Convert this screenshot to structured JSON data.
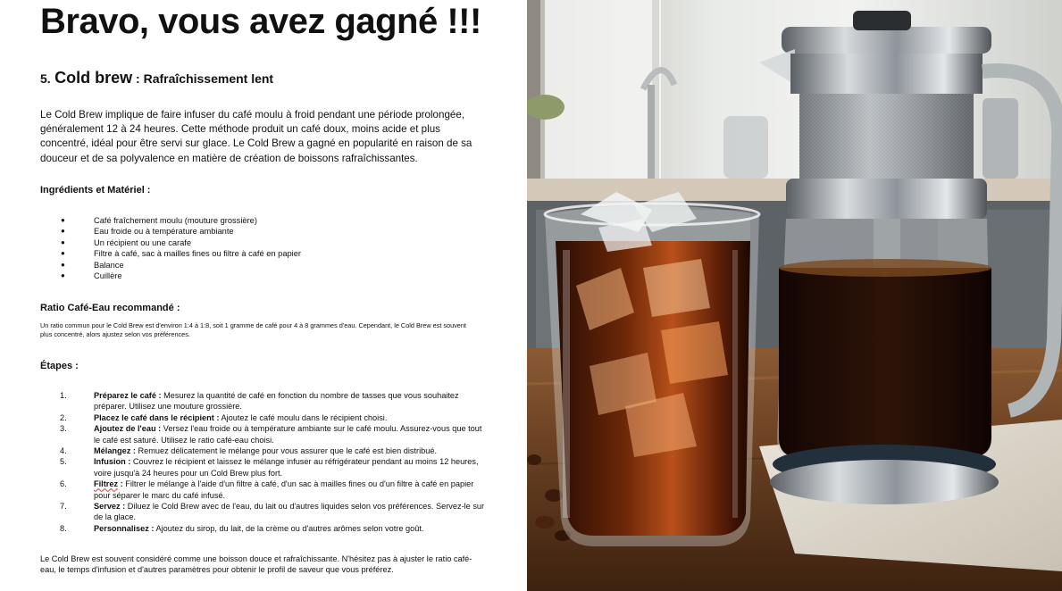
{
  "page_title": "Bravo, vous avez gagné !!!",
  "section": {
    "number": "5.",
    "title_main": "Cold brew",
    "title_rest": " : Rafraîchissement lent"
  },
  "intro": "Le Cold Brew implique de faire infuser du café moulu à froid pendant une période prolongée, généralement 12 à 24 heures. Cette méthode produit un café doux, moins acide et plus concentré, idéal pour être servi sur glace. Le Cold Brew a gagné en popularité en raison de sa douceur et de sa polyvalence en matière de création de boissons rafraîchissantes.",
  "ingredients": {
    "heading": "Ingrédients et Matériel :",
    "bullet": "●",
    "items": [
      "Café fraîchement moulu (mouture grossière)",
      "Eau froide ou à température ambiante",
      "Un récipient ou une carafe",
      "Filtre à café, sac à mailles fines ou filtre à café en papier",
      "Balance",
      "Cuillère"
    ]
  },
  "ratio": {
    "heading": "Ratio Café-Eau recommandé :",
    "text": "Un ratio commun pour le Cold Brew est d'environ 1:4 à 1:8, soit 1 gramme de café pour 4 à 8 grammes d'eau. Cependant, le Cold Brew est souvent plus concentré, alors ajustez selon vos préférences."
  },
  "steps": {
    "heading": "Étapes :",
    "items": [
      {
        "num": "1.",
        "title": "Préparez le café :",
        "text": " Mesurez la quantité de café en fonction du nombre de tasses que vous souhaitez préparer. Utilisez une mouture grossière."
      },
      {
        "num": "2.",
        "title": "Placez le café dans le récipient :",
        "text": " Ajoutez le café moulu dans le récipient choisi."
      },
      {
        "num": "3.",
        "title": "Ajoutez de l'eau :",
        "text": " Versez l'eau froide ou à température ambiante sur le café moulu. Assurez-vous que tout le café est saturé. Utilisez le ratio café-eau choisi."
      },
      {
        "num": "4.",
        "title": "Mélangez :",
        "text": " Remuez délicatement le mélange pour vous assurer que le café est bien distribué."
      },
      {
        "num": "5.",
        "title": "Infusion :",
        "text": " Couvrez le récipient et laissez le mélange infuser au réfrigérateur pendant au moins 12 heures, voire jusqu'à 24 heures pour un Cold Brew plus fort."
      },
      {
        "num": "6.",
        "title": "Filtrez",
        "title_rest": " :",
        "text": " Filtrer le mélange à l'aide d'un filtre à café, d'un sac à mailles fines ou d'un filtre à café en papier pour séparer le marc du café infusé."
      },
      {
        "num": "7.",
        "title": "Servez :",
        "text": " Diluez le Cold Brew avec de l'eau, du lait ou d'autres liquides selon vos préférences. Servez-le sur de la glace."
      },
      {
        "num": "8.",
        "title": "Personnalisez :",
        "text": " Ajoutez du sirop, du lait, de la crème ou d'autres arômes selon votre goût."
      }
    ]
  },
  "conclusion": "Le Cold Brew est souvent considéré comme une boisson douce et rafraîchissante. N'hésitez pas à ajuster le ratio café-eau, le temps d'infusion et d'autres paramètres pour obtenir le profil de saveur que vous préférez."
}
